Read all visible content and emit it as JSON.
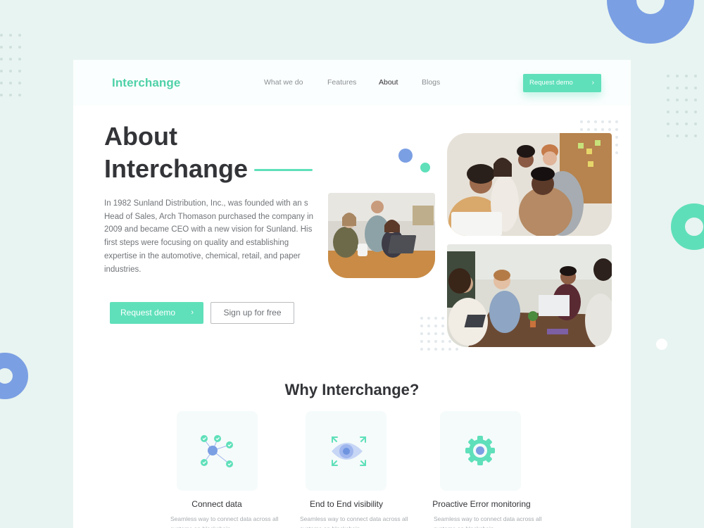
{
  "brand": {
    "logo": "Interchange",
    "accent": "#5fe0ba",
    "secondary": "#7b9fe3"
  },
  "nav": {
    "items": [
      {
        "label": "What we do",
        "active": false
      },
      {
        "label": "Features",
        "active": false
      },
      {
        "label": "About",
        "active": true
      },
      {
        "label": "Blogs",
        "active": false
      }
    ],
    "cta_label": "Request demo"
  },
  "hero": {
    "title_line1": "About",
    "title_line2": "Interchange",
    "body": "In 1982 Sunland Distribution, Inc., was founded with an s Head of Sales, Arch Thomason purchased the company in 2009 and became CEO with a new vision for Sunland. His first steps were focusing on quality and establishing expertise in the automotive, chemical, retail, and paper industries.",
    "primary_button": "Request demo",
    "secondary_button": "Sign up for free"
  },
  "why": {
    "title": "Why Interchange?",
    "features": [
      {
        "title": "Connect data",
        "icon": "network-icon",
        "description": "Seamless way to connect data across all systems on blockchain"
      },
      {
        "title": "End to End visibility",
        "icon": "eye-expand-icon",
        "description": "Seamless way to connect data across all systems on blockchain"
      },
      {
        "title": "Proactive Error monitoring",
        "icon": "gear-icon",
        "description": "Seamless way to connect data across all systems on blockchain"
      }
    ]
  },
  "icons": {
    "chevron": "›"
  }
}
